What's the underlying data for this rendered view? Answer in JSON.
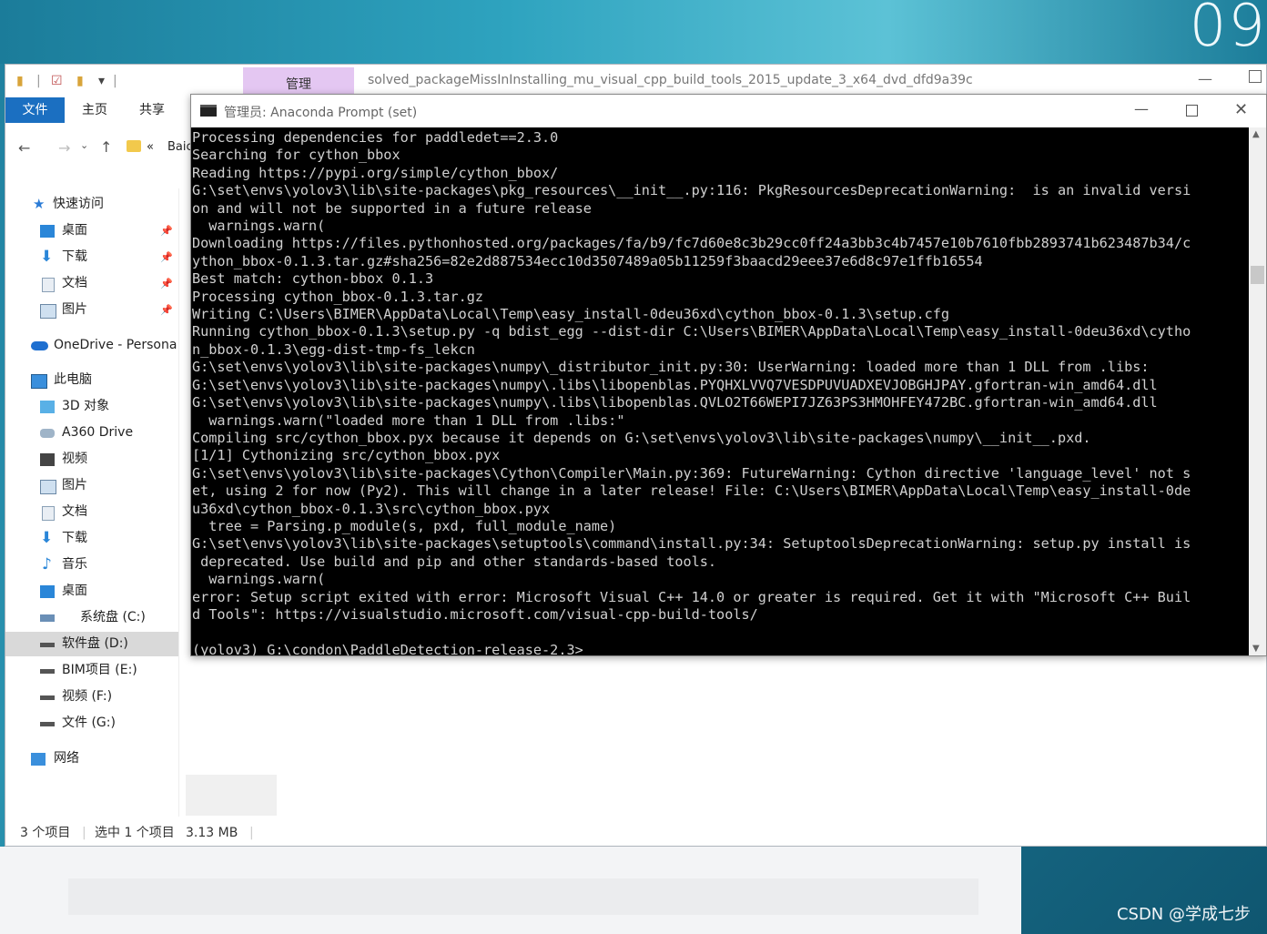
{
  "desktop": {
    "clock_text": "09",
    "watermark": "CSDN @学成七步"
  },
  "explorer": {
    "title_path": "solved_packageMissInInstalling_mu_visual_cpp_build_tools_2015_update_3_x64_dvd_dfd9a39c",
    "manage_tab": "管理",
    "ribbon_tabs": [
      "文件",
      "主页",
      "共享"
    ],
    "breadcrumb_chevron": "«",
    "breadcrumb_text": "Baic",
    "sidebar": [
      {
        "label": "快速访问",
        "icon": "star-icon",
        "pinned": false
      },
      {
        "label": "桌面",
        "icon": "desktop-icon",
        "pinned": true
      },
      {
        "label": "下载",
        "icon": "download-icon",
        "pinned": true
      },
      {
        "label": "文档",
        "icon": "document-icon",
        "pinned": true
      },
      {
        "label": "图片",
        "icon": "picture-icon",
        "pinned": true
      },
      {
        "label": "OneDrive - Persona",
        "icon": "cloud-icon",
        "pinned": false
      },
      {
        "label": "此电脑",
        "icon": "computer-icon",
        "pinned": false
      },
      {
        "label": "3D 对象",
        "icon": "cube-icon",
        "pinned": false
      },
      {
        "label": "A360 Drive",
        "icon": "drive-icon",
        "pinned": false
      },
      {
        "label": "视频",
        "icon": "video-icon",
        "pinned": false
      },
      {
        "label": "图片",
        "icon": "picture-icon",
        "pinned": false
      },
      {
        "label": "文档",
        "icon": "document-icon",
        "pinned": false
      },
      {
        "label": "下载",
        "icon": "download-icon",
        "pinned": false
      },
      {
        "label": "音乐",
        "icon": "music-icon",
        "pinned": false
      },
      {
        "label": "桌面",
        "icon": "desktop-icon",
        "pinned": false
      },
      {
        "label": "系统盘 (C:)",
        "icon": "system-drive-icon",
        "pinned": false
      },
      {
        "label": "软件盘 (D:)",
        "icon": "drive-icon",
        "pinned": false,
        "selected": true
      },
      {
        "label": "BIM项目 (E:)",
        "icon": "drive-icon",
        "pinned": false
      },
      {
        "label": "视频 (F:)",
        "icon": "drive-icon",
        "pinned": false
      },
      {
        "label": "文件 (G:)",
        "icon": "drive-icon",
        "pinned": false
      },
      {
        "label": "网络",
        "icon": "network-icon",
        "pinned": false
      }
    ],
    "status": {
      "count": "3 个项目",
      "selected": "选中 1 个项目",
      "size": "3.13 MB"
    }
  },
  "console": {
    "title": "管理员: Anaconda Prompt (set)",
    "lines": [
      "Processing dependencies for paddledet==2.3.0",
      "Searching for cython_bbox",
      "Reading https://pypi.org/simple/cython_bbox/",
      "G:\\set\\envs\\yolov3\\lib\\site-packages\\pkg_resources\\__init__.py:116: PkgResourcesDeprecationWarning:  is an invalid versi",
      "on and will not be supported in a future release",
      "  warnings.warn(",
      "Downloading https://files.pythonhosted.org/packages/fa/b9/fc7d60e8c3b29cc0ff24a3bb3c4b7457e10b7610fbb2893741b623487b34/c",
      "ython_bbox-0.1.3.tar.gz#sha256=82e2d887534ecc10d3507489a05b11259f3baacd29eee37e6d8c97e1ffb16554",
      "Best match: cython-bbox 0.1.3",
      "Processing cython_bbox-0.1.3.tar.gz",
      "Writing C:\\Users\\BIMER\\AppData\\Local\\Temp\\easy_install-0deu36xd\\cython_bbox-0.1.3\\setup.cfg",
      "Running cython_bbox-0.1.3\\setup.py -q bdist_egg --dist-dir C:\\Users\\BIMER\\AppData\\Local\\Temp\\easy_install-0deu36xd\\cytho",
      "n_bbox-0.1.3\\egg-dist-tmp-fs_lekcn",
      "G:\\set\\envs\\yolov3\\lib\\site-packages\\numpy\\_distributor_init.py:30: UserWarning: loaded more than 1 DLL from .libs:",
      "G:\\set\\envs\\yolov3\\lib\\site-packages\\numpy\\.libs\\libopenblas.PYQHXLVVQ7VESDPUVUADXEVJOBGHJPAY.gfortran-win_amd64.dll",
      "G:\\set\\envs\\yolov3\\lib\\site-packages\\numpy\\.libs\\libopenblas.QVLO2T66WEPI7JZ63PS3HMOHFEY472BC.gfortran-win_amd64.dll",
      "  warnings.warn(\"loaded more than 1 DLL from .libs:\"",
      "Compiling src/cython_bbox.pyx because it depends on G:\\set\\envs\\yolov3\\lib\\site-packages\\numpy\\__init__.pxd.",
      "[1/1] Cythonizing src/cython_bbox.pyx",
      "G:\\set\\envs\\yolov3\\lib\\site-packages\\Cython\\Compiler\\Main.py:369: FutureWarning: Cython directive 'language_level' not s",
      "et, using 2 for now (Py2). This will change in a later release! File: C:\\Users\\BIMER\\AppData\\Local\\Temp\\easy_install-0de",
      "u36xd\\cython_bbox-0.1.3\\src\\cython_bbox.pyx",
      "  tree = Parsing.p_module(s, pxd, full_module_name)",
      "G:\\set\\envs\\yolov3\\lib\\site-packages\\setuptools\\command\\install.py:34: SetuptoolsDeprecationWarning: setup.py install is",
      " deprecated. Use build and pip and other standards-based tools.",
      "  warnings.warn(",
      "error: Setup script exited with error: Microsoft Visual C++ 14.0 or greater is required. Get it with \"Microsoft C++ Buil",
      "d Tools\": https://visualstudio.microsoft.com/visual-cpp-build-tools/",
      "",
      "(yolov3) G:\\condon\\PaddleDetection-release-2.3>"
    ]
  }
}
